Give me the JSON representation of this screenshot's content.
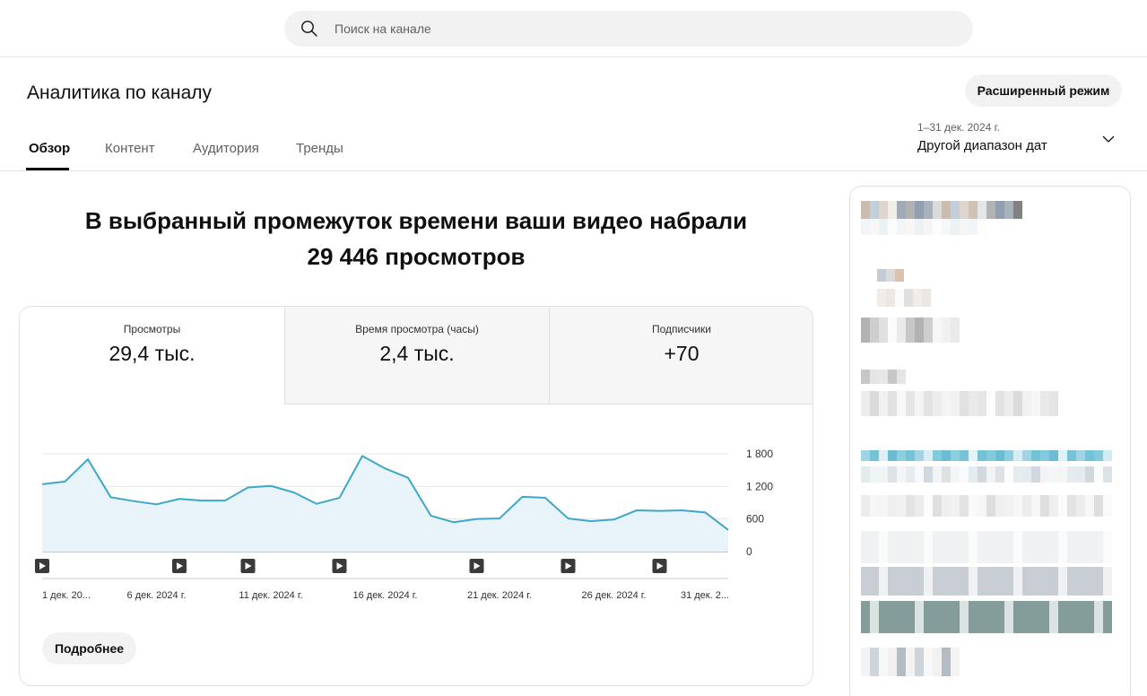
{
  "search": {
    "placeholder": "Поиск на канале",
    "icon": "search-icon"
  },
  "page": {
    "title": "Аналитика по каналу",
    "advanced_button": "Расширенный режим"
  },
  "tabs": [
    {
      "label": "Обзор",
      "active": true
    },
    {
      "label": "Контент",
      "active": false
    },
    {
      "label": "Аудитория",
      "active": false
    },
    {
      "label": "Тренды",
      "active": false
    }
  ],
  "date_range": {
    "period": "1–31 дек. 2024 г.",
    "label": "Другой диапазон дат",
    "icon": "chevron-down-icon"
  },
  "headline": {
    "line1": "В выбранный промежуток времени ваши видео набрали",
    "line2": "29 446 просмотров"
  },
  "metrics": [
    {
      "label": "Просмотры",
      "value": "29,4 тыс."
    },
    {
      "label": "Время просмотра (часы)",
      "value": "2,4 тыс."
    },
    {
      "label": "Подписчики",
      "value": "+70"
    }
  ],
  "more_button": "Подробнее",
  "colors": {
    "line": "#3ea6c9",
    "fill": "#e8f4f9",
    "accent": "#0f0f0f"
  },
  "chart_data": {
    "type": "area",
    "x": [
      "1 дек.",
      "2 дек.",
      "3 дек.",
      "4 дек.",
      "5 дек.",
      "6 дек.",
      "7 дек.",
      "8 дек.",
      "9 дек.",
      "10 дек.",
      "11 дек.",
      "12 дек.",
      "13 дек.",
      "14 дек.",
      "15 дек.",
      "16 дек.",
      "17 дек.",
      "18 дек.",
      "19 дек.",
      "20 дек.",
      "21 дек.",
      "22 дек.",
      "23 дек.",
      "24 дек.",
      "25 дек.",
      "26 дек.",
      "27 дек.",
      "28 дек.",
      "29 дек.",
      "30 дек.",
      "31 дек."
    ],
    "series": [
      {
        "values": [
          1240,
          1290,
          1700,
          1000,
          930,
          870,
          970,
          940,
          940,
          1180,
          1210,
          1090,
          880,
          990,
          1760,
          1530,
          1360,
          660,
          540,
          600,
          610,
          1010,
          990,
          610,
          560,
          590,
          760,
          750,
          760,
          720,
          400
        ]
      }
    ],
    "ylim": [
      0,
      1800
    ],
    "yticks": [
      "1 800",
      "1 200",
      "600",
      "0"
    ],
    "xtick_labels": [
      "1 дек. 20...",
      "6 дек. 2024 г.",
      "11 дек. 2024 г.",
      "16 дек. 2024 г.",
      "21 дек. 2024 г.",
      "26 дек. 2024 г.",
      "31 дек. 2..."
    ],
    "xtick_days": [
      1,
      6,
      11,
      16,
      21,
      26,
      31
    ],
    "video_marker_days": [
      1,
      7,
      10,
      14,
      20,
      24,
      28
    ],
    "grid": true
  }
}
